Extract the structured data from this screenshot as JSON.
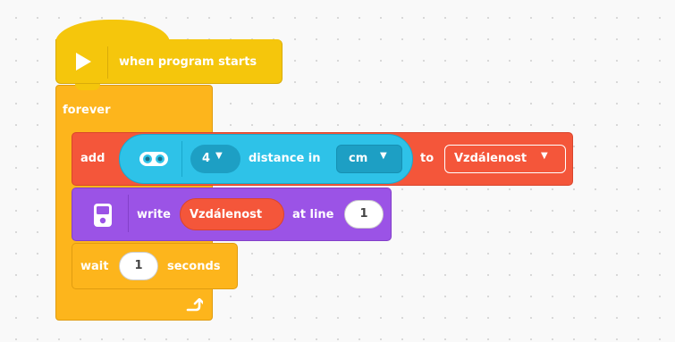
{
  "event_block": {
    "label": "when program starts",
    "icon": "play-icon"
  },
  "forever_block": {
    "label": "forever",
    "icon": "loop-arrow-icon"
  },
  "add_block": {
    "label": "add",
    "sensor": {
      "icon": "distance-sensor-icon",
      "port": "4",
      "text": "distance in",
      "unit": "cm"
    },
    "to_label": "to",
    "variable": "Vzdálenost"
  },
  "write_block": {
    "icon": "hub-display-icon",
    "label": "write",
    "variable": "Vzdálenost",
    "at_line_label": "at line",
    "line": "1"
  },
  "wait_block": {
    "label": "wait",
    "value": "1",
    "unit": "seconds"
  },
  "colors": {
    "events": "#f5c60c",
    "control": "#fdb51c",
    "variables": "#f4563a",
    "sensors": "#2ec2e8",
    "display": "#9b53e6"
  }
}
